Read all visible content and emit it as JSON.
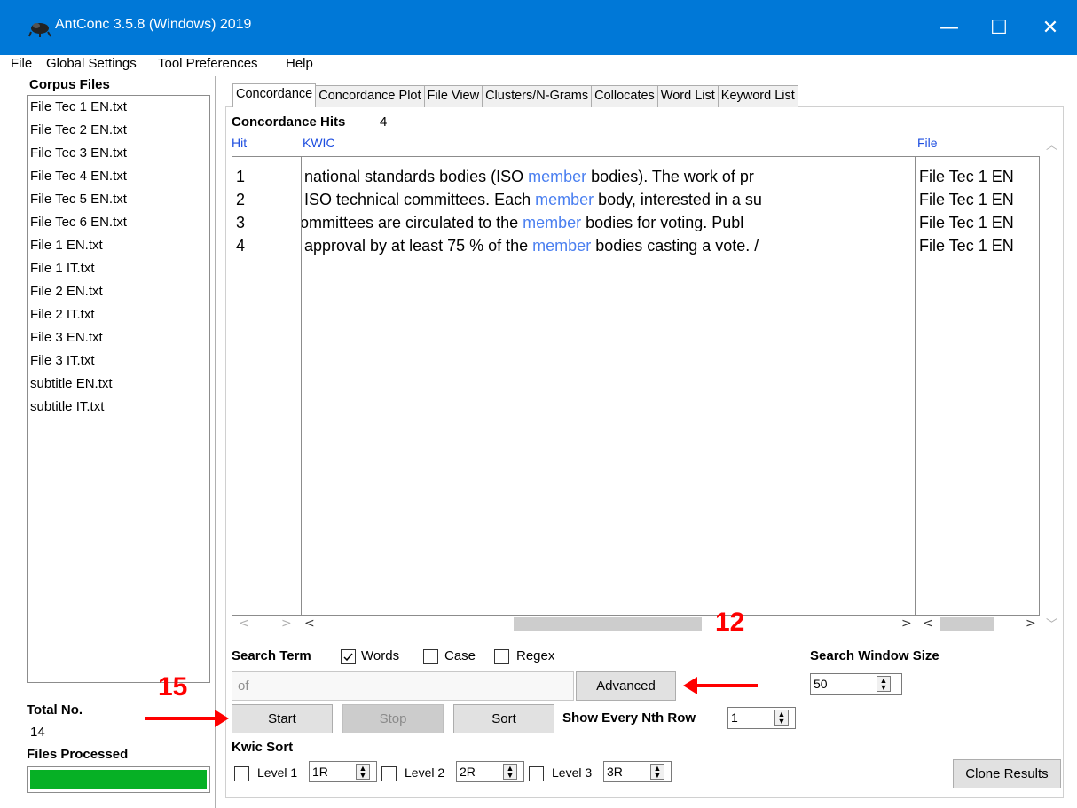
{
  "window": {
    "title": "AntConc 3.5.8 (Windows) 2019",
    "controls": {
      "minimize": "—",
      "maximize": "☐",
      "close": "✕"
    },
    "colors": {
      "titlebar": "#0078d7",
      "keyword": "#4a7ff0",
      "header": "#1f4fe0",
      "progress": "#06b025",
      "annotation": "#ff0000"
    }
  },
  "menu": [
    "File",
    "Global Settings",
    "Tool Preferences",
    "Help"
  ],
  "left_panel": {
    "corpus_label": "Corpus Files",
    "files": [
      "File Tec 1 EN.txt",
      "File Tec 2 EN.txt",
      "File Tec 3 EN.txt",
      "File Tec 4 EN.txt",
      "File Tec 5 EN.txt",
      "File Tec 6 EN.txt",
      "File 1 EN.txt",
      "File 1 IT.txt",
      "File 2 EN.txt",
      "File 2 IT.txt",
      "File 3 EN.txt",
      "File 3 IT.txt",
      "subtitle EN.txt",
      "subtitle IT.txt"
    ],
    "total_label": "Total No.",
    "total_value": "14",
    "processed_label": "Files Processed",
    "progress_fraction": 1.0
  },
  "tabs": [
    "Concordance",
    "Concordance Plot",
    "File View",
    "Clusters/N-Grams",
    "Collocates",
    "Word List",
    "Keyword List"
  ],
  "active_tab": 0,
  "concordance": {
    "hits_label": "Concordance Hits",
    "hits_count": "4",
    "headers": {
      "hit": "Hit",
      "kwic": "KWIC",
      "file": "File"
    },
    "rows": [
      {
        "hit": "1",
        "left": "national standards  bodies (ISO ",
        "keyword": "member",
        "right": " bodies). The work of pr",
        "file": "File Tec 1 EN"
      },
      {
        "hit": "2",
        "left": " ISO technical committees. Each ",
        "keyword": "member",
        "right": " body, interested in a su",
        "file": "File Tec 1 EN"
      },
      {
        "hit": "3",
        "left": "ommittees are circulated to the ",
        "keyword": "member",
        "right": " bodies for voting.  Publ",
        "file": "File Tec 1 EN"
      },
      {
        "hit": "4",
        "left": "approval by at least 75 % of the ",
        "keyword": "member",
        "right": " bodies  casting a vote. /",
        "file": "File Tec 1 EN"
      }
    ]
  },
  "search": {
    "label": "Search Term",
    "words_label": "Words",
    "case_label": "Case",
    "regex_label": "Regex",
    "words_checked": true,
    "case_checked": false,
    "regex_checked": false,
    "placeholder": "of",
    "advanced_label": "Advanced",
    "window_size_label": "Search Window Size",
    "window_size_value": "50"
  },
  "actions": {
    "start_label": "Start",
    "stop_label": "Stop",
    "sort_label": "Sort",
    "nth_label": "Show Every Nth Row",
    "nth_value": "1"
  },
  "kwic_sort": {
    "label": "Kwic Sort",
    "levels": [
      {
        "label": "Level 1",
        "value": "1R"
      },
      {
        "label": "Level 2",
        "value": "2R"
      },
      {
        "label": "Level 3",
        "value": "3R"
      }
    ],
    "clone_label": "Clone Results"
  },
  "annotations": {
    "a12": "12",
    "a15": "15"
  }
}
